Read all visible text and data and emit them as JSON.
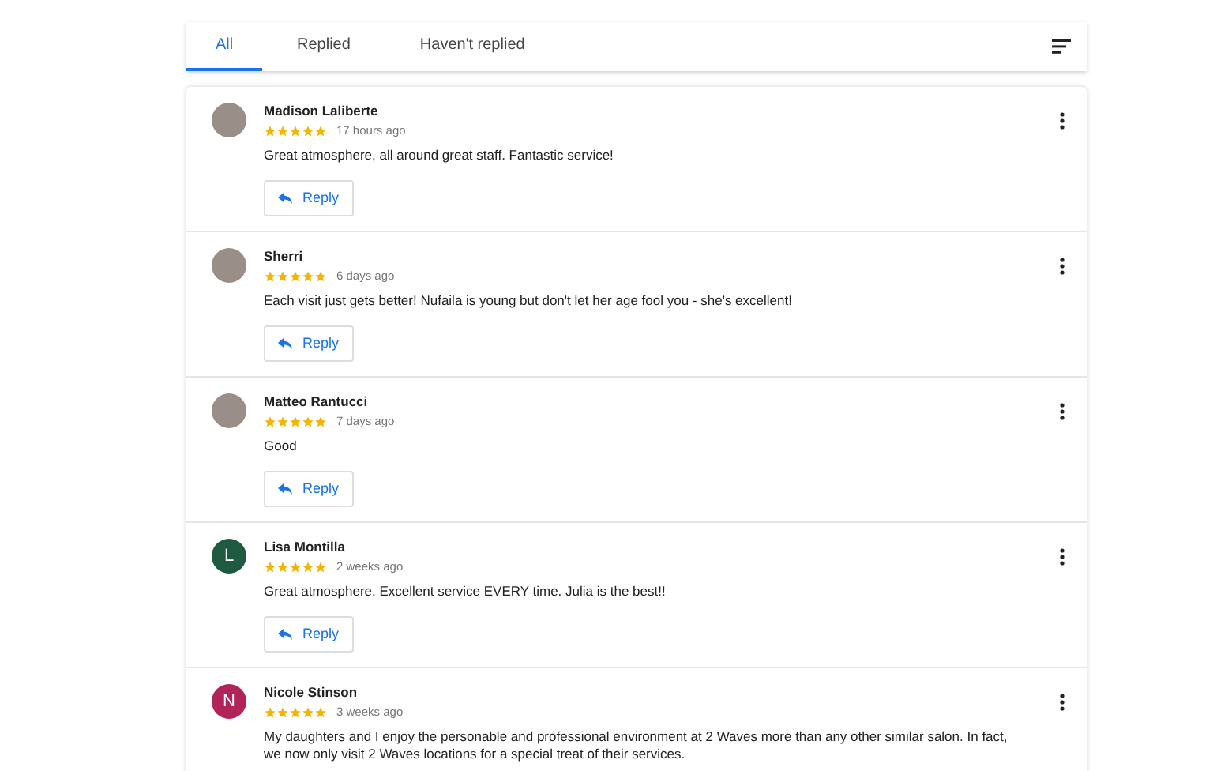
{
  "tabs": [
    {
      "label": "All",
      "selected": true
    },
    {
      "label": "Replied",
      "selected": false
    },
    {
      "label": "Haven't replied",
      "selected": false
    }
  ],
  "reviews": [
    {
      "name": "Madison Laliberte",
      "avatar": {
        "kind": "photo"
      },
      "stars": 5,
      "time": "17 hours ago",
      "text": "Great atmosphere, all around great staff. Fantastic service!",
      "reply": "Reply"
    },
    {
      "name": "Sherri",
      "avatar": {
        "kind": "photo"
      },
      "stars": 5,
      "time": "6 days ago",
      "text": "Each visit just gets better! Nufaila is young but don't let her age fool you - she's excellent!",
      "reply": "Reply"
    },
    {
      "name": "Matteo Rantucci",
      "avatar": {
        "kind": "photo"
      },
      "stars": 5,
      "time": "7 days ago",
      "text": "Good",
      "reply": "Reply"
    },
    {
      "name": "Lisa Montilla",
      "avatar": {
        "kind": "letter",
        "letter": "L",
        "color": "#1e5a3f"
      },
      "stars": 5,
      "time": "2 weeks ago",
      "text": "Great atmosphere. Excellent service EVERY time. Julia is the best!!",
      "reply": "Reply"
    },
    {
      "name": "Nicole Stinson",
      "avatar": {
        "kind": "letter",
        "letter": "N",
        "color": "#b0245a"
      },
      "stars": 5,
      "time": "3 weeks ago",
      "text": "My daughters and I enjoy the personable and professional environment at 2 Waves more than any other similar salon. In fact, we now only visit 2 Waves locations for a special treat of their services."
    }
  ]
}
